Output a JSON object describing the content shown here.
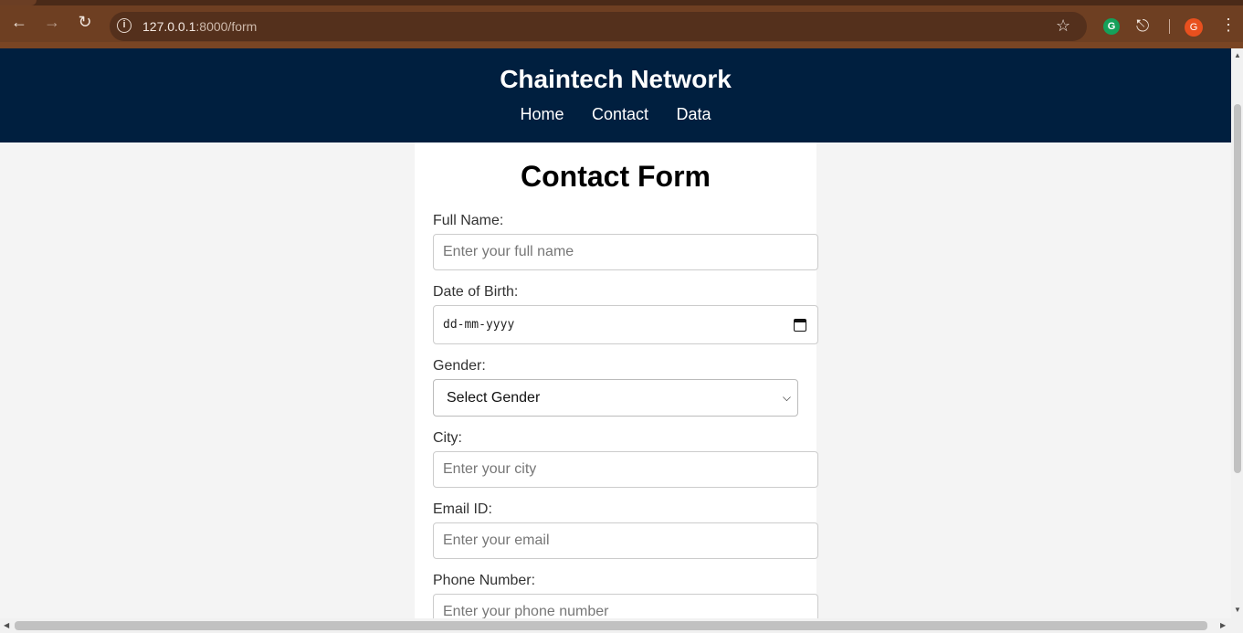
{
  "browser": {
    "url_host": "127.0.0.1",
    "url_path": ":8000/form",
    "extension_label": "G",
    "profile_initial": "G",
    "icons": [
      "back-arrow-icon",
      "forward-arrow-icon",
      "reload-icon",
      "info-icon",
      "star-icon",
      "grammarly-icon",
      "puzzle-icon",
      "menu-dots-icon"
    ]
  },
  "header": {
    "title": "Chaintech Network",
    "nav": [
      "Home",
      "Contact",
      "Data"
    ]
  },
  "form": {
    "title": "Contact Form",
    "full_name": {
      "label": "Full Name:",
      "placeholder": "Enter your full name"
    },
    "dob": {
      "label": "Date of Birth:",
      "placeholder": "dd-mm-yyyy"
    },
    "gender": {
      "label": "Gender:",
      "selected": "Select Gender"
    },
    "city": {
      "label": "City:",
      "placeholder": "Enter your city"
    },
    "email": {
      "label": "Email ID:",
      "placeholder": "Enter your email"
    },
    "phone": {
      "label": "Phone Number:",
      "placeholder": "Enter your phone number"
    }
  },
  "colors": {
    "header_bg": "#001f3f",
    "browser_toolbar": "#6e3f22",
    "page_bg": "#f4f4f4"
  }
}
